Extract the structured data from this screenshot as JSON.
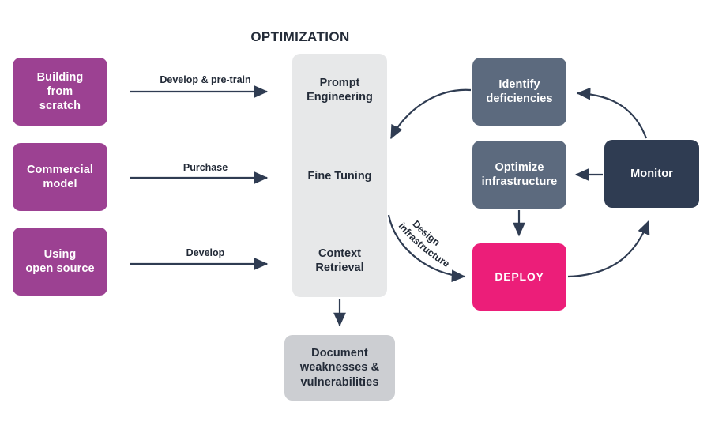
{
  "diagram": {
    "title": "OPTIMIZATION",
    "sources": [
      {
        "label": "Building\nfrom\nscratch",
        "edge": "Develop & pre-train"
      },
      {
        "label": "Commercial\nmodel",
        "edge": "Purchase"
      },
      {
        "label": "Using\nopen source",
        "edge": "Develop"
      }
    ],
    "optimization_stages": [
      {
        "label": "Prompt\nEngineering"
      },
      {
        "label": "Fine Tuning"
      },
      {
        "label": "Context\nRetrieval"
      }
    ],
    "document_node": {
      "label": "Document\nweaknesses &\nvulnerabilities"
    },
    "cycle": [
      {
        "id": "identify",
        "label": "Identify\ndeficiencies"
      },
      {
        "id": "optimize",
        "label": "Optimize\ninfrastructure"
      },
      {
        "id": "monitor",
        "label": "Monitor"
      },
      {
        "id": "deploy",
        "label": "DEPLOY"
      }
    ],
    "curved_edges": [
      {
        "id": "design-infrastructure",
        "line1": "Design",
        "line2": "infrastructure"
      }
    ],
    "colors": {
      "source_box": "#9C4192",
      "optimization_column": "#E7E8E9",
      "cycle_box": "#5C6A7E",
      "monitor_box": "#2F3C52",
      "deploy_box": "#EC1E79",
      "document_box": "#CCCED2",
      "arrow": "#2F3C52",
      "text_dark": "#232B38",
      "text_light": "#FFFFFF"
    }
  }
}
